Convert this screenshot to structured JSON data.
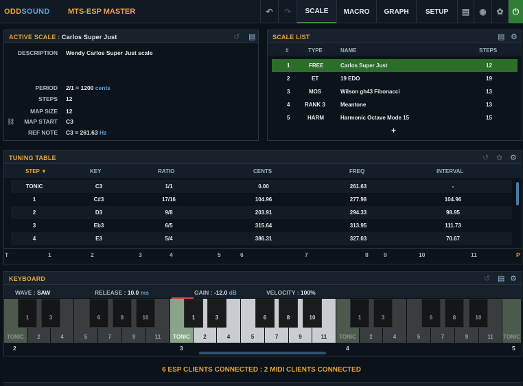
{
  "top": {
    "logo_odd": "ODD",
    "logo_sound": "SOUND",
    "title": "MTS-ESP MASTER",
    "tabs": [
      "SCALE",
      "MACRO",
      "GRAPH",
      "SETUP"
    ]
  },
  "active_scale": {
    "title_prefix": "ACTIVE SCALE :",
    "title_name": "Carlos Super Just",
    "fields": {
      "description_label": "DESCRIPTION",
      "description": "Wendy Carlos Super Just scale",
      "period_label": "PERIOD",
      "period": "2/1 = 1200",
      "period_unit": "cents",
      "steps_label": "STEPS",
      "steps": "12",
      "map_size_label": "MAP SIZE",
      "map_size": "12",
      "map_start_label": "MAP START",
      "map_start": "C3",
      "ref_note_label": "REF NOTE",
      "ref_note": "C3 = 261.63",
      "ref_unit": "Hz"
    }
  },
  "scale_list": {
    "title": "SCALE LIST",
    "headers": [
      "#",
      "TYPE",
      "NAME",
      "STEPS"
    ],
    "rows": [
      [
        "1",
        "FREE",
        "Carlos Super Just",
        "12"
      ],
      [
        "2",
        "ET",
        "19 EDO",
        "19"
      ],
      [
        "3",
        "MOS",
        "Wilson gh43 Fibonacci",
        "13"
      ],
      [
        "4",
        "RANK 3",
        "Meantone",
        "13"
      ],
      [
        "5",
        "HARM",
        "Harmonic Octave Mode 15",
        "15"
      ]
    ],
    "add": "+"
  },
  "tuning_table": {
    "title": "TUNING TABLE",
    "headers": [
      "STEP ▼",
      "KEY",
      "RATIO",
      "CENTS",
      "FREQ",
      "INTERVAL"
    ],
    "rows": [
      [
        "TONIC",
        "C3",
        "1/1",
        "0.00",
        "261.63",
        "-"
      ],
      [
        "1",
        "C#3",
        "17/16",
        "104.96",
        "277.98",
        "104.96"
      ],
      [
        "2",
        "D3",
        "9/8",
        "203.91",
        "294.33",
        "98.95"
      ],
      [
        "3",
        "Eb3",
        "6/5",
        "315.64",
        "313.95",
        "111.73"
      ],
      [
        "4",
        "E3",
        "5/4",
        "386.31",
        "327.03",
        "70.67"
      ]
    ],
    "ruler": [
      "T",
      "1",
      "2",
      "3",
      "4",
      "5",
      "6",
      "7",
      "8",
      "9",
      "10",
      "11",
      "P"
    ]
  },
  "keyboard": {
    "title": "KEYBOARD",
    "wave_label": "WAVE",
    "wave": "SAW",
    "release_label": "RELEASE",
    "release": "10.0",
    "release_unit": "ms",
    "gain_label": "GAIN",
    "gain": "-12.0",
    "gain_unit": "dB",
    "velocity_label": "VELOCITY",
    "velocity": "100%",
    "octaves": [
      "2",
      "3",
      "4",
      "5"
    ],
    "white_labels": [
      "TONIC",
      "2",
      "4",
      "5",
      "7",
      "9",
      "11"
    ],
    "black_labels": [
      "1",
      "3",
      "6",
      "8",
      "10"
    ]
  },
  "status": {
    "text": "6 ESP CLIENTS CONNECTED : 2 MIDI CLIENTS CONNECTED"
  }
}
